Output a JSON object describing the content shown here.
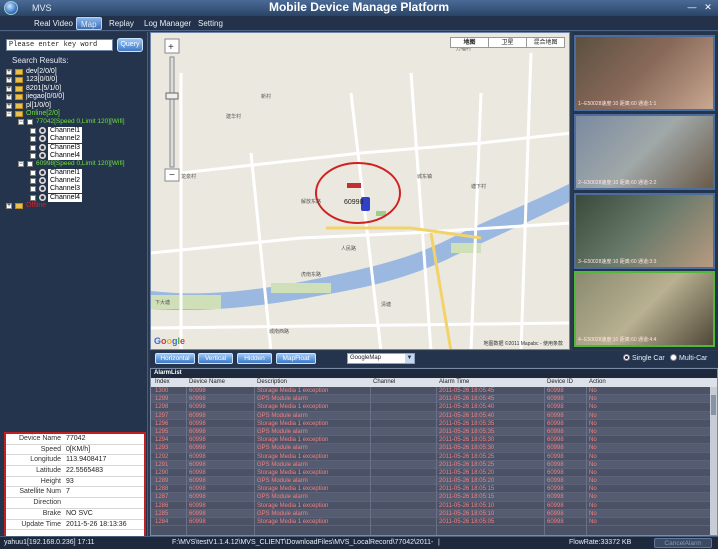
{
  "window": {
    "app_name": "MVS",
    "title": "Mobile Device Manage Platform"
  },
  "menu": {
    "items": [
      "Real Video",
      "Map",
      "Replay",
      "Log Manager",
      "Setting"
    ],
    "active": "Map"
  },
  "search": {
    "placeholder": "Please enter key word",
    "query_label": "Query",
    "results_label": "Search Results:"
  },
  "tree": [
    {
      "label": "dev[2/0/0]",
      "level": 0,
      "state": "normal"
    },
    {
      "label": "123[0/0/0]",
      "level": 0,
      "state": "normal"
    },
    {
      "label": "8201[5/1/0]",
      "level": 0,
      "state": "normal"
    },
    {
      "label": "jiegao[0/0/0]",
      "level": 0,
      "state": "normal"
    },
    {
      "label": "pl[1/0/0]",
      "level": 0,
      "state": "normal"
    },
    {
      "label": "Online[2/0]",
      "level": 0,
      "state": "online"
    },
    {
      "label": "77042[Speed 0,Limit 120][Wifi]",
      "level": 1,
      "state": "online"
    },
    {
      "label": "Channel1",
      "level": 2,
      "state": "channel"
    },
    {
      "label": "Channel2",
      "level": 2,
      "state": "channel"
    },
    {
      "label": "Channel3",
      "level": 2,
      "state": "channel"
    },
    {
      "label": "Channel4",
      "level": 2,
      "state": "channel"
    },
    {
      "label": "60998[Speed 0,Limit 120][Wifi]",
      "level": 1,
      "state": "online"
    },
    {
      "label": "Channel1",
      "level": 2,
      "state": "channel"
    },
    {
      "label": "Channel2",
      "level": 2,
      "state": "channel"
    },
    {
      "label": "Channel3",
      "level": 2,
      "state": "channel"
    },
    {
      "label": "Channel4",
      "level": 2,
      "state": "channel"
    },
    {
      "label": "Offline",
      "level": 0,
      "state": "offline"
    }
  ],
  "device_info": [
    {
      "key": "Device Name",
      "value": "77042"
    },
    {
      "key": "Speed",
      "value": "0[KM/h]"
    },
    {
      "key": "Longitude",
      "value": "113.9408417"
    },
    {
      "key": "Latitude",
      "value": "22.5565483"
    },
    {
      "key": "Height",
      "value": "93"
    },
    {
      "key": "Satellite Num",
      "value": "7"
    },
    {
      "key": "Direction",
      "value": ""
    },
    {
      "key": "Brake",
      "value": "NO SVC"
    },
    {
      "key": "Update Time",
      "value": "2011-5-26 18:13:36"
    }
  ],
  "map": {
    "tabs": [
      "地图",
      "卫星",
      "混合地图"
    ],
    "selected_tab": "地图",
    "marker_label": "60998",
    "copyright": "地图数据 ©2011 Mapabc - 使用条款",
    "logo": "Google",
    "labels": [
      {
        "text": "万福村"
      },
      {
        "text": "龙泉村"
      },
      {
        "text": "城东镇"
      },
      {
        "text": "塘下村"
      },
      {
        "text": "人民路"
      },
      {
        "text": "城南西路"
      },
      {
        "text": "虎南东路"
      },
      {
        "text": "清塘"
      },
      {
        "text": "下大塘"
      },
      {
        "text": "建华村"
      },
      {
        "text": "新村"
      },
      {
        "text": "解放东路"
      }
    ]
  },
  "video_feeds": [
    {
      "caption": "1--E50028速度:10 距离:60 通道:1:1",
      "colors": [
        "#5b5040",
        "#8a6a5a",
        "#c8a890"
      ]
    },
    {
      "caption": "2--E50028速度:10 距离:60 通道:2:2",
      "colors": [
        "#7a8aa0",
        "#a0a8a8",
        "#6a5a48"
      ]
    },
    {
      "caption": "3--E50028速度:10 距离:60 通道:3:3",
      "colors": [
        "#3a4a3a",
        "#6a7a6a",
        "#b89a80"
      ]
    },
    {
      "caption": "4--E50028速度:10 距离:60 通道:4:4",
      "colors": [
        "#8a8a70",
        "#b8b090",
        "#504838"
      ]
    }
  ],
  "controls": {
    "buttons": [
      "Horizontal",
      "Vertical",
      "Hidden",
      "MapFloat"
    ],
    "map_select": "GoogleMap",
    "radio_single": "Single Car",
    "radio_multi": "Multi-Car",
    "radio_selected": "Single Car"
  },
  "alarm": {
    "title": "AlarmList",
    "columns": [
      "Index",
      "Device Name",
      "Description",
      "Channel",
      "Alarm Time",
      "Device ID",
      "Action"
    ],
    "rows": [
      [
        "1300",
        "60998",
        "Storage Media 1 exception",
        "",
        "2011-05-26 18:05:45",
        "60998",
        "No"
      ],
      [
        "1299",
        "60998",
        "GPS Module alarm",
        "",
        "2011-05-26 18:05:45",
        "60998",
        "No"
      ],
      [
        "1298",
        "60998",
        "Storage Media 1 exception",
        "",
        "2011-05-26 18:05:40",
        "60998",
        "No"
      ],
      [
        "1297",
        "60998",
        "GPS Module alarm",
        "",
        "2011-05-26 18:05:40",
        "60998",
        "No"
      ],
      [
        "1296",
        "60998",
        "Storage Media 1 exception",
        "",
        "2011-05-26 18:05:35",
        "60998",
        "No"
      ],
      [
        "1295",
        "60998",
        "GPS Module alarm",
        "",
        "2011-05-26 18:05:35",
        "60998",
        "No"
      ],
      [
        "1294",
        "60998",
        "Storage Media 1 exception",
        "",
        "2011-05-26 18:05:30",
        "60998",
        "No"
      ],
      [
        "1293",
        "60998",
        "GPS Module alarm",
        "",
        "2011-05-26 18:05:30",
        "60998",
        "No"
      ],
      [
        "1292",
        "60998",
        "Storage Media 1 exception",
        "",
        "2011-05-26 18:05:25",
        "60998",
        "No"
      ],
      [
        "1291",
        "60998",
        "GPS Module alarm",
        "",
        "2011-05-26 18:05:25",
        "60998",
        "No"
      ],
      [
        "1290",
        "60998",
        "Storage Media 1 exception",
        "",
        "2011-05-26 18:05:20",
        "60998",
        "No"
      ],
      [
        "1289",
        "60998",
        "GPS Module alarm",
        "",
        "2011-05-26 18:05:20",
        "60998",
        "No"
      ],
      [
        "1288",
        "60998",
        "Storage Media 1 exception",
        "",
        "2011-05-26 18:05:15",
        "60998",
        "No"
      ],
      [
        "1287",
        "60998",
        "GPS Module alarm",
        "",
        "2011-05-26 18:05:15",
        "60998",
        "No"
      ],
      [
        "1286",
        "60998",
        "Storage Media 1 exception",
        "",
        "2011-05-26 18:05:10",
        "60998",
        "No"
      ],
      [
        "1285",
        "60998",
        "GPS Module alarm",
        "",
        "2011-05-26 18:05:10",
        "60998",
        "No"
      ],
      [
        "1284",
        "60998",
        "Storage Media 1 exception",
        "",
        "2011-05-26 18:05:05",
        "60998",
        "No"
      ]
    ]
  },
  "status": {
    "user": "yahuu1[192.168.0.236] 17:11",
    "path": "F:\\MVS\\testV1.1.4.12\\MVS_CLIENT\\DownloadFiles\\MVS_LocalRecord\\77042\\2011-",
    "sep": "|",
    "flow_rate": "FlowRate:33372 KB",
    "cancel_alarm": "CancelAlarm"
  },
  "colors": {
    "panel_bg": "#24344c",
    "accent_blue": "#3e78c4",
    "online_green": "#6ee03c",
    "alarm_text": "#f08080",
    "highlight_red": "#c02020"
  }
}
